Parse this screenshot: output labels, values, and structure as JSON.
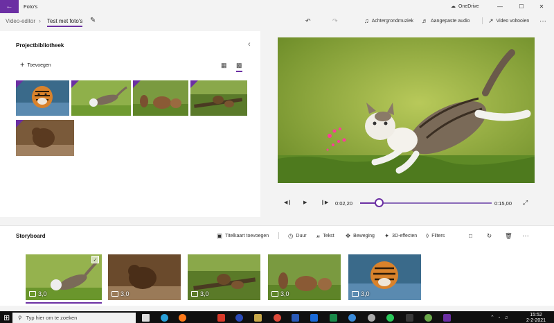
{
  "app": {
    "title": "Foto's",
    "onedrive_label": "OneDrive"
  },
  "window_controls": {
    "minimize": "—",
    "maximize": "☐",
    "close": "✕"
  },
  "breadcrumb": {
    "root": "Video-editor",
    "current": "Test met foto's"
  },
  "toolbar": {
    "undo_icon": "undo-icon",
    "redo_icon": "redo-icon",
    "background_music": "Achtergrondmuziek",
    "custom_audio": "Aangepaste audio",
    "finish_video": "Video voltooien",
    "more": "···"
  },
  "library": {
    "title": "Projectbibliotheek",
    "add_label": "Toevoegen",
    "items": [
      {
        "name": "tiger-water"
      },
      {
        "name": "kitten-jump"
      },
      {
        "name": "bears-meadow"
      },
      {
        "name": "bears-cubs-logs"
      },
      {
        "name": "bear-river"
      }
    ]
  },
  "playback": {
    "current_time": "0:02,20",
    "total_time": "0:15,00",
    "progress": 0.147
  },
  "storyboard": {
    "title": "Storyboard",
    "tools": {
      "title_card": "Titelkaart toevoegen",
      "duration": "Duur",
      "text": "Tekst",
      "motion": "Beweging",
      "effects_3d": "3D-effecten",
      "filters": "Filters"
    },
    "clips": [
      {
        "duration": "3,0",
        "selected": true
      },
      {
        "duration": "3,0",
        "selected": false
      },
      {
        "duration": "3,0",
        "selected": false
      },
      {
        "duration": "3,0",
        "selected": false
      },
      {
        "duration": "3,0",
        "selected": false
      }
    ]
  },
  "taskbar": {
    "search_placeholder": "Typ hier om te zoeken",
    "time": "15:52",
    "date": "2-2-2021"
  },
  "colors": {
    "accent": "#6b2fa3"
  }
}
